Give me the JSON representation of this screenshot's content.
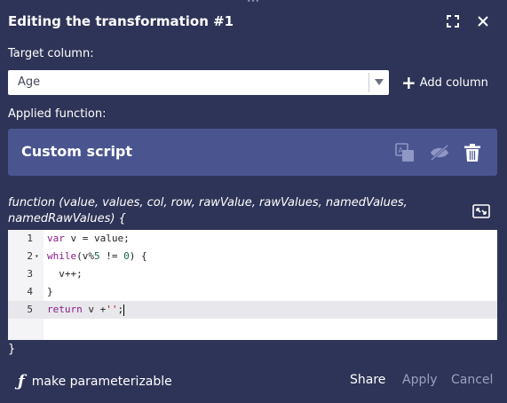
{
  "dialog": {
    "title": "Editing the transformation #1",
    "header_icons": [
      "fullscreen-icon",
      "close-icon"
    ]
  },
  "target": {
    "label": "Target column:",
    "selected": "Age",
    "add_column_label": "Add column"
  },
  "applied": {
    "label": "Applied function:",
    "function_name": "Custom script",
    "icons": [
      "translate-icon",
      "hide-icon",
      "trash-icon"
    ]
  },
  "signature": "function (value, values, col, row, rawValue, rawValues, namedValues, namedRawValues) {",
  "editor": {
    "lines": [
      {
        "n": "1",
        "code": "var v = value;"
      },
      {
        "n": "2",
        "code": "while(v%5 != 0) {"
      },
      {
        "n": "3",
        "code": "  v++;"
      },
      {
        "n": "4",
        "code": "}"
      },
      {
        "n": "5",
        "code": "return v +'';"
      }
    ],
    "closing": "}"
  },
  "footer": {
    "parameterize_label": "make parameterizable",
    "share": "Share",
    "apply": "Apply",
    "cancel": "Cancel"
  },
  "colors": {
    "background": "#2e3457",
    "function_box": "#4a5590",
    "keyword": "#8b1a8b",
    "number": "#116644",
    "string": "#aa1111"
  }
}
